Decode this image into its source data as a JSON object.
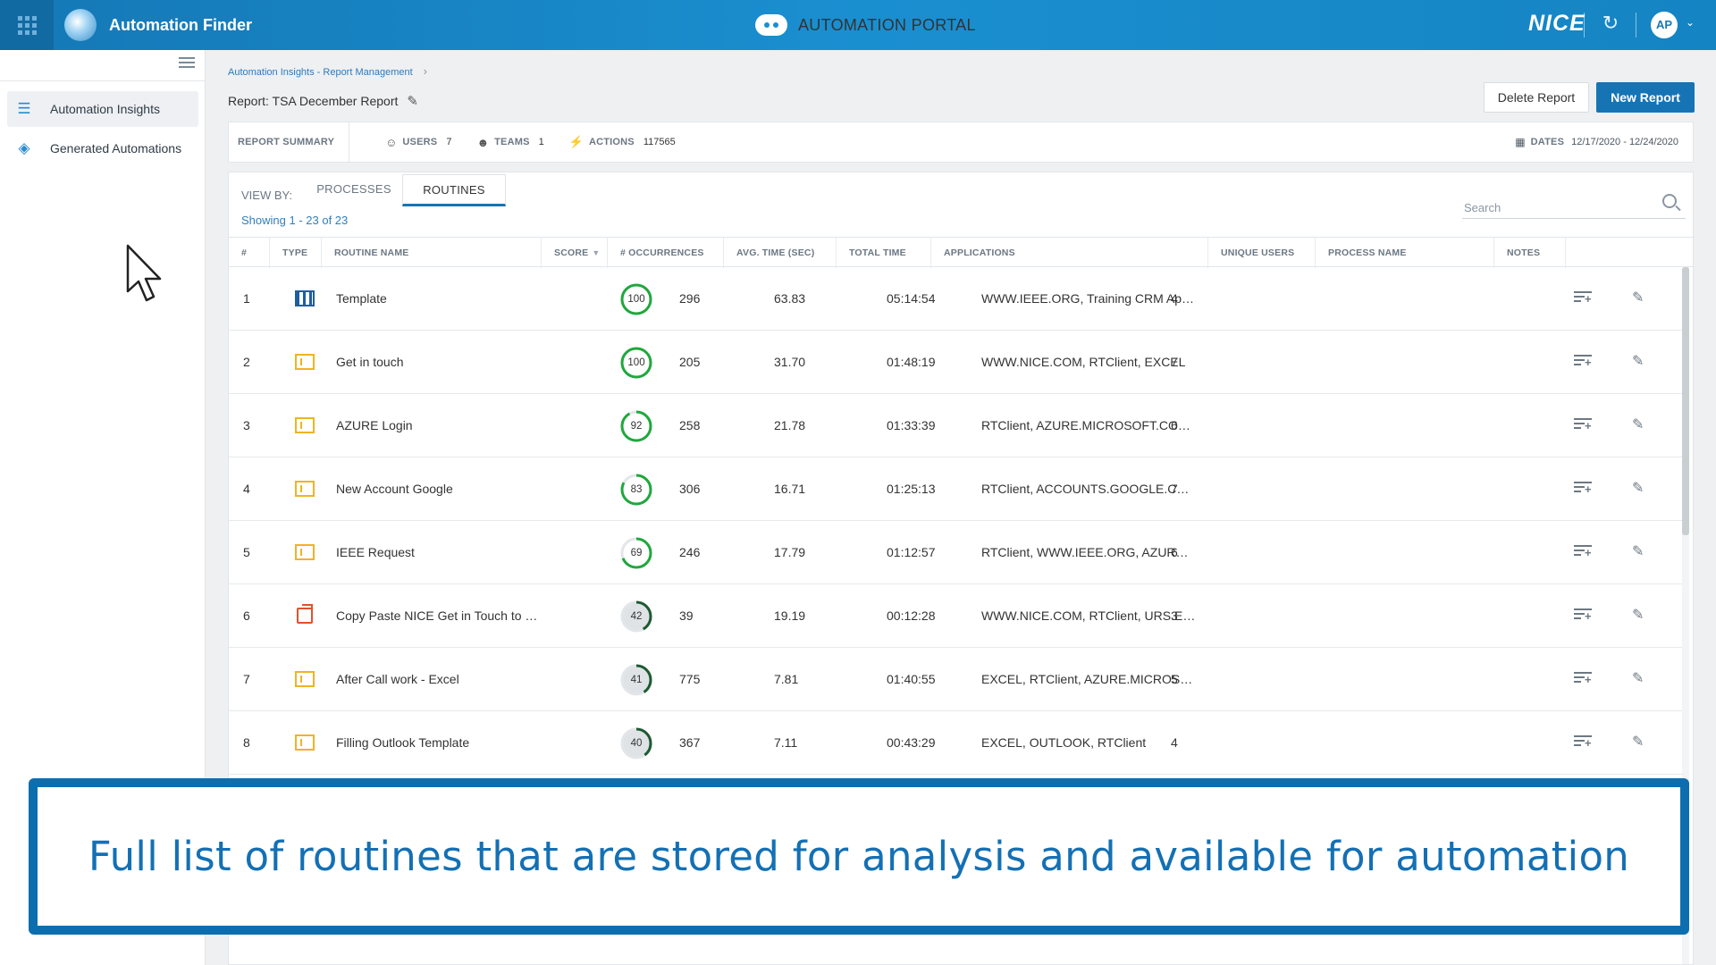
{
  "header": {
    "app_title": "Automation Finder",
    "portal_title": "AUTOMATION PORTAL",
    "brand": "NICE",
    "user_initials": "AP",
    "accent_color": "#1a8fd0"
  },
  "sidebar": {
    "items": [
      {
        "label": "Automation Insights",
        "icon": "sliders-icon",
        "active": true
      },
      {
        "label": "Generated Automations",
        "icon": "layers-icon",
        "active": false
      }
    ]
  },
  "breadcrumb": "Automation Insights - Report Management",
  "report": {
    "title": "Report: TSA December Report",
    "delete_label": "Delete Report",
    "new_label": "New Report"
  },
  "summary": {
    "label": "REPORT SUMMARY",
    "users_label": "USERS",
    "users": "7",
    "teams_label": "TEAMS",
    "teams": "1",
    "actions_label": "ACTIONS",
    "actions": "117565",
    "dates_label": "DATES",
    "dates": "12/17/2020  -  12/24/2020"
  },
  "view": {
    "label": "VIEW BY:",
    "tabs": [
      "PROCESSES",
      "ROUTINES"
    ],
    "active_tab": "ROUTINES",
    "showing": "Showing 1 - 23 of 23",
    "search_placeholder": "Search"
  },
  "table": {
    "columns": [
      "#",
      "TYPE",
      "ROUTINE NAME",
      "SCORE",
      "# OCCURRENCES",
      "AVG. TIME (SEC)",
      "TOTAL TIME",
      "APPLICATIONS",
      "UNIQUE USERS",
      "PROCESS NAME",
      "NOTES"
    ],
    "rows": [
      {
        "num": "1",
        "type": "grid",
        "name": "Template",
        "score": 100,
        "occ": "296",
        "avg": "63.83",
        "total": "05:14:54",
        "apps": "WWW.IEEE.ORG, Training CRM Applicati...",
        "users": "4",
        "process": ""
      },
      {
        "num": "2",
        "type": "yellow",
        "name": "Get in touch",
        "score": 100,
        "occ": "205",
        "avg": "31.70",
        "total": "01:48:19",
        "apps": "WWW.NICE.COM, RTClient, EXCEL",
        "users": "7",
        "process": ""
      },
      {
        "num": "3",
        "type": "yellow",
        "name": "AZURE Login",
        "score": 92,
        "occ": "258",
        "avg": "21.78",
        "total": "01:33:39",
        "apps": "RTClient, AZURE.MICROSOFT.COM, EXCEL",
        "users": "6",
        "process": ""
      },
      {
        "num": "4",
        "type": "yellow",
        "name": "New Account Google",
        "score": 83,
        "occ": "306",
        "avg": "16.71",
        "total": "01:25:13",
        "apps": "RTClient, ACCOUNTS.GOOGLE.COM, EXC...",
        "users": "7",
        "process": ""
      },
      {
        "num": "5",
        "type": "yellow",
        "name": "IEEE Request",
        "score": 69,
        "occ": "246",
        "avg": "17.79",
        "total": "01:12:57",
        "apps": "RTClient, WWW.IEEE.ORG, AZURE.MICRO...",
        "users": "6",
        "process": ""
      },
      {
        "num": "6",
        "type": "orange",
        "name": "Copy Paste NICE Get in Touch to EART...",
        "score": 42,
        "occ": "39",
        "avg": "19.19",
        "total": "00:12:28",
        "apps": "WWW.NICE.COM, RTClient, URS.EARTHD...",
        "users": "3",
        "process": ""
      },
      {
        "num": "7",
        "type": "yellow",
        "name": "After Call work - Excel",
        "score": 41,
        "occ": "775",
        "avg": "7.81",
        "total": "01:40:55",
        "apps": "EXCEL, RTClient, AZURE.MICROSOFT.COM",
        "users": "5",
        "process": ""
      },
      {
        "num": "8",
        "type": "yellow",
        "name": "Filling Outlook Template",
        "score": 40,
        "occ": "367",
        "avg": "7.11",
        "total": "00:43:29",
        "apps": "EXCEL, OUTLOOK, RTClient",
        "users": "4",
        "process": ""
      }
    ]
  },
  "caption": "Full list of routines that are stored for analysis and available for automation",
  "colors": {
    "score_green": "#1fa83c",
    "score_dark": "#1e5a32",
    "caption_blue": "#1470b4"
  }
}
